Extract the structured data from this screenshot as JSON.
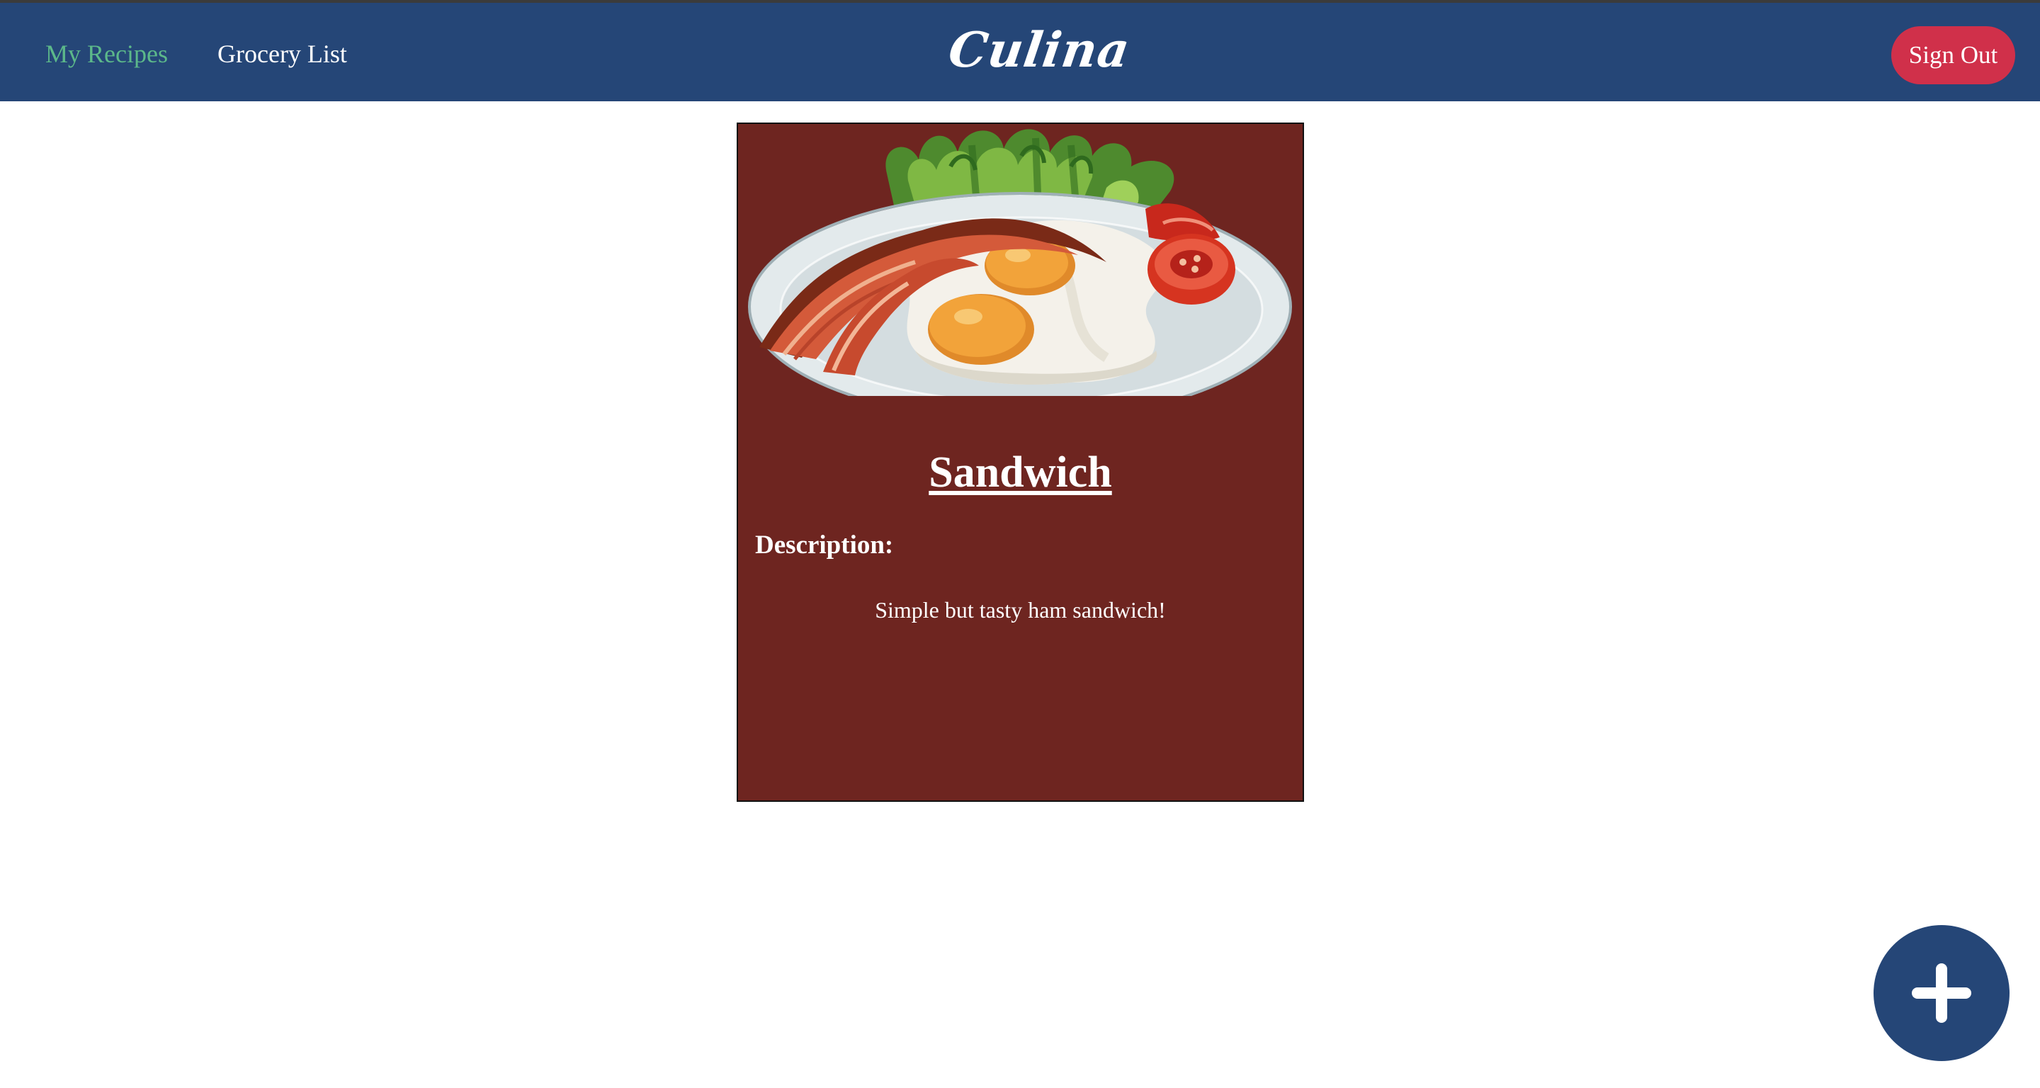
{
  "nav": {
    "links": [
      {
        "label": "My Recipes",
        "active": true
      },
      {
        "label": "Grocery List",
        "active": false
      }
    ],
    "brand": "Culina",
    "sign_out_label": "Sign Out"
  },
  "recipes": [
    {
      "image_icon": "breakfast-plate-image",
      "title": "Sandwich",
      "description_label": "Description:",
      "description": "Simple but tasty ham sandwich!"
    }
  ],
  "add_button_icon": "plus-icon",
  "colors": {
    "navbar": "#254677",
    "active_link": "#5cb88a",
    "sign_out": "#d0304a",
    "card": "#6e2520",
    "fab": "#254677"
  }
}
